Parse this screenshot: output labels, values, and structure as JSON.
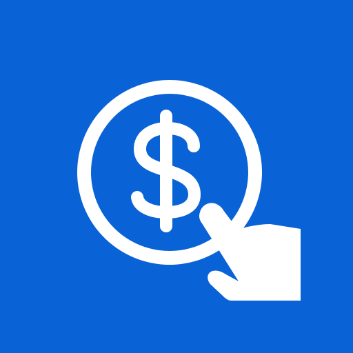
{
  "icon": {
    "name": "pay-by-tap",
    "glyphs": [
      "coin-circle-icon",
      "dollar-sign-icon",
      "pointing-hand-icon"
    ],
    "colors": {
      "background": "#0a63d6",
      "foreground": "#ffffff"
    }
  }
}
